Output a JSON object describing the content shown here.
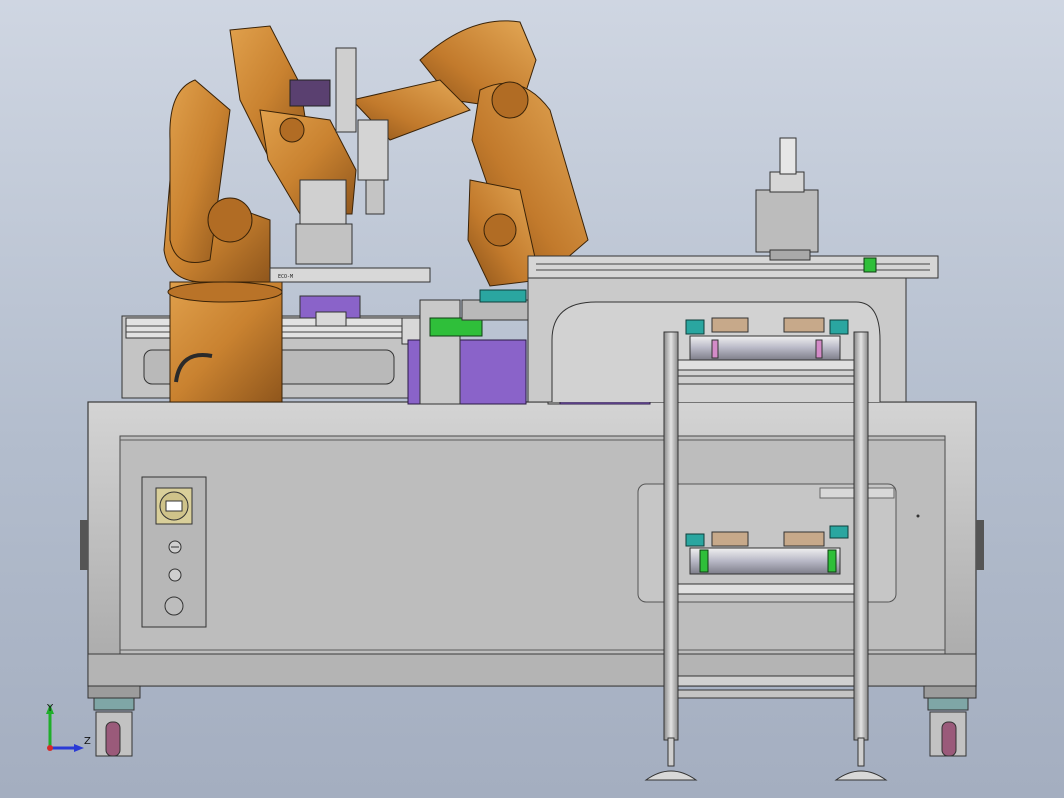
{
  "triad": {
    "y_label": "Y",
    "z_label": "Z",
    "y_color": "#1fae2a",
    "z_color": "#2a3ad6",
    "x_color": "#d62a2a"
  },
  "model": {
    "robot_color": "#c98230",
    "frame_color": "#bcbcbc",
    "fixture_color": "#8a63c9",
    "accent_green": "#2fbf3a",
    "accent_teal": "#2aa6a0",
    "tag_text": "ECO-M"
  },
  "panel": {
    "icons": [
      "selector-switch-icon",
      "indicator-lamp-icon",
      "indicator-lamp-icon",
      "push-button-icon"
    ]
  }
}
